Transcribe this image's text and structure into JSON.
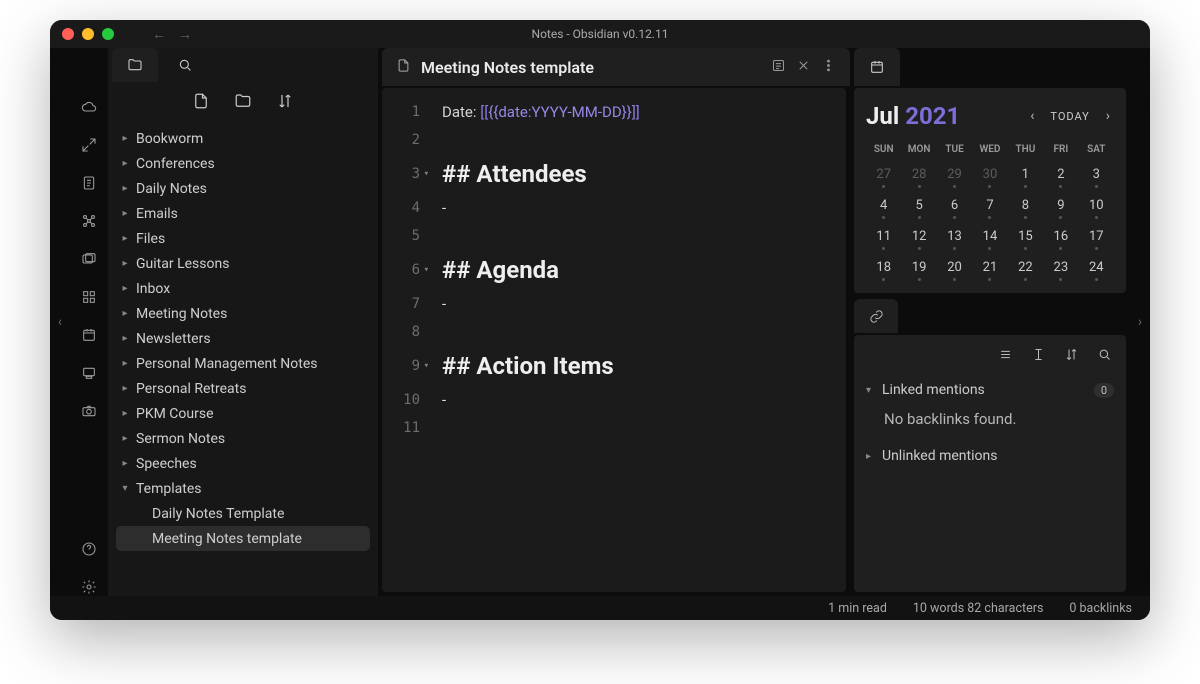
{
  "window": {
    "title": "Notes - Obsidian v0.12.11"
  },
  "tree": {
    "folders": [
      "Bookworm",
      "Conferences",
      "Daily Notes",
      "Emails",
      "Files",
      "Guitar Lessons",
      "Inbox",
      "Meeting Notes",
      "Newsletters",
      "Personal Management Notes",
      "Personal Retreats",
      "PKM Course",
      "Sermon Notes",
      "Speeches"
    ],
    "templates_label": "Templates",
    "template_children": [
      "Daily Notes Template",
      "Meeting Notes template"
    ],
    "selected": "Meeting Notes template"
  },
  "tab": {
    "title": "Meeting Notes template"
  },
  "editor": {
    "date_label": "Date: ",
    "link_outer_open": "[[",
    "link_inner": "{{date:YYYY-MM-DD}}",
    "link_outer_close": "]]",
    "h_attendees": "## Attendees",
    "h_agenda": "## Agenda",
    "h_action": "## Action Items",
    "bullet": "-"
  },
  "calendar": {
    "month": "Jul",
    "year": "2021",
    "today_label": "TODAY",
    "dow": [
      "SUN",
      "MON",
      "TUE",
      "WED",
      "THU",
      "FRI",
      "SAT"
    ],
    "rows": [
      [
        {
          "d": "27",
          "o": true
        },
        {
          "d": "28",
          "o": true
        },
        {
          "d": "29",
          "o": true
        },
        {
          "d": "30",
          "o": true
        },
        {
          "d": "1"
        },
        {
          "d": "2"
        },
        {
          "d": "3"
        }
      ],
      [
        {
          "d": "4"
        },
        {
          "d": "5"
        },
        {
          "d": "6"
        },
        {
          "d": "7"
        },
        {
          "d": "8"
        },
        {
          "d": "9"
        },
        {
          "d": "10"
        }
      ],
      [
        {
          "d": "11"
        },
        {
          "d": "12"
        },
        {
          "d": "13"
        },
        {
          "d": "14"
        },
        {
          "d": "15"
        },
        {
          "d": "16"
        },
        {
          "d": "17"
        }
      ],
      [
        {
          "d": "18"
        },
        {
          "d": "19"
        },
        {
          "d": "20"
        },
        {
          "d": "21"
        },
        {
          "d": "22"
        },
        {
          "d": "23"
        },
        {
          "d": "24"
        }
      ]
    ]
  },
  "backlinks": {
    "linked_label": "Linked mentions",
    "linked_count": "0",
    "empty": "No backlinks found.",
    "unlinked_label": "Unlinked mentions"
  },
  "status": {
    "read": "1 min read",
    "words": "10 words 82 characters",
    "backlinks": "0 backlinks"
  }
}
